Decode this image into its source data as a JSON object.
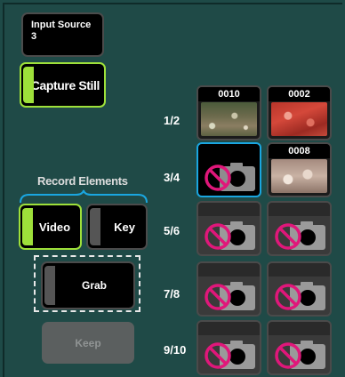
{
  "input_source": {
    "label": "Input Source",
    "value": "3"
  },
  "capture_still": {
    "label": "Capture Still"
  },
  "record_elements": {
    "title": "Record Elements",
    "video_label": "Video",
    "key_label": "Key"
  },
  "grab": {
    "label": "Grab"
  },
  "keep": {
    "label": "Keep"
  },
  "rows": [
    "1/2",
    "3/4",
    "5/6",
    "7/8",
    "9/10"
  ],
  "slots": {
    "s1": "0010",
    "s2": "0002",
    "s4": "0008"
  },
  "colors": {
    "accent_green": "#9ee03a",
    "selected_blue": "#1aa6e0",
    "no_symbol": "#e0177a",
    "background": "#1f4a47"
  }
}
